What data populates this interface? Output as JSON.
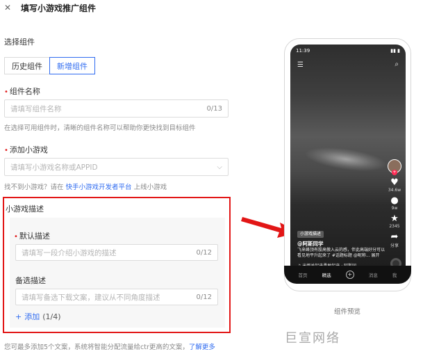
{
  "header": {
    "close_glyph": "✕",
    "title": "填写小游戏推广组件"
  },
  "choose_component": {
    "label": "选择组件",
    "options": [
      "历史组件",
      "新增组件"
    ],
    "selected": "新增组件"
  },
  "component_name": {
    "label": "组件名称",
    "placeholder": "请填写组件名称",
    "count": "0/13",
    "hint": "在选择可用组件时，清晰的组件名称可以帮助你更快找到目标组件"
  },
  "add_game": {
    "label": "添加小游戏",
    "placeholder": "请填写小游戏名称或APPID",
    "hint_prefix": "找不到小游戏？请在",
    "hint_link": "快手小游戏开发者平台",
    "hint_suffix": "上线小游戏"
  },
  "game_desc": {
    "label": "小游戏描述",
    "default_label": "默认描述",
    "default_placeholder": "请填写一段介绍小游戏的描述",
    "default_count": "0/12",
    "alt_label": "备选描述",
    "alt_placeholder": "请填写备选下载文案，建议从不同角度描述",
    "alt_count": "0/12",
    "add_label": "添加",
    "add_count": "(1/4)"
  },
  "footer": {
    "note": "您可最多添加5个文案，系统将智能分配流量给ctr更高的文案，",
    "link": "了解更多"
  },
  "phone": {
    "time": "11:39",
    "status_right": "▮▮ ▮",
    "like_count": "34.6w",
    "comment_count": "9w",
    "fav_count": "2345",
    "share_label": "分享",
    "tag": "小游戏描述",
    "author": "@阿斯同学",
    "desc": "飞来峰顶有股高傲入云的感，伴此高端好分可以看见地平升起来了 #话题标题 @昵称... 展开",
    "music": "♫ 米娜关起来勇敢起来 · 阿斯同",
    "nav": [
      "首页",
      "精选",
      "+",
      "消息",
      "我"
    ]
  },
  "preview_caption": "组件预览",
  "watermark": "巨宣网络",
  "colors": {
    "accent": "#2f6bf0",
    "highlight": "#e21616",
    "required": "#e02020"
  }
}
